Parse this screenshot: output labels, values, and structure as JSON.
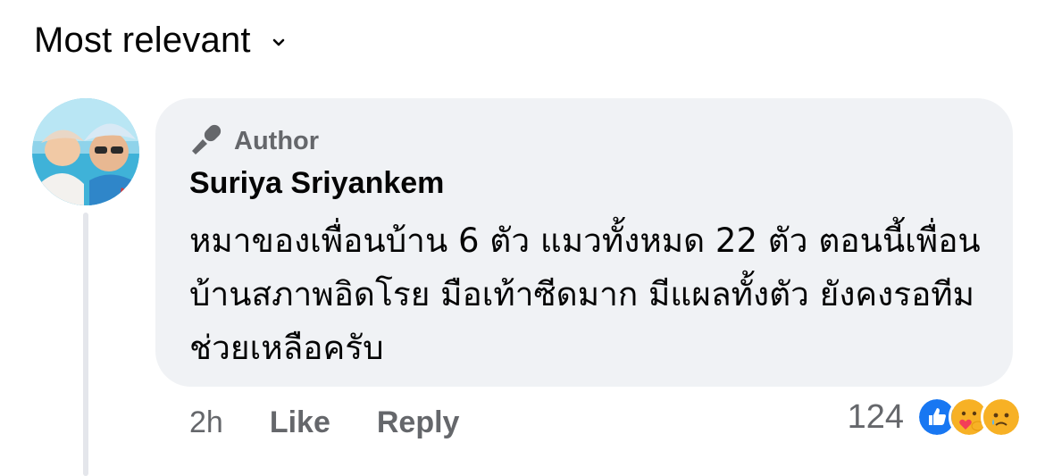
{
  "sort": {
    "label": "Most relevant",
    "icon": "chevron-down-icon"
  },
  "comment": {
    "badge_icon": "microphone-icon",
    "badge_label": "Author",
    "author_name": "Suriya Sriyankem",
    "text": "หมาของเพื่อนบ้าน 6 ตัว แมวทั้งหมด 22 ตัว ตอนนี้เพื่อนบ้านสภาพอิดโรย มือเท้าซีดมาก มีแผลทั้งตัว ยังคงรอทีมช่วยเหลือครับ",
    "timestamp": "2h",
    "like_label": "Like",
    "reply_label": "Reply",
    "reaction_count": "124",
    "reactions": [
      "like-reaction-icon",
      "care-reaction-icon",
      "sad-reaction-icon"
    ]
  },
  "colors": {
    "bubble": "#f0f2f5",
    "secondary_text": "#65676b",
    "like_blue": "#1877f2",
    "reaction_yellow": "#f7b125"
  }
}
